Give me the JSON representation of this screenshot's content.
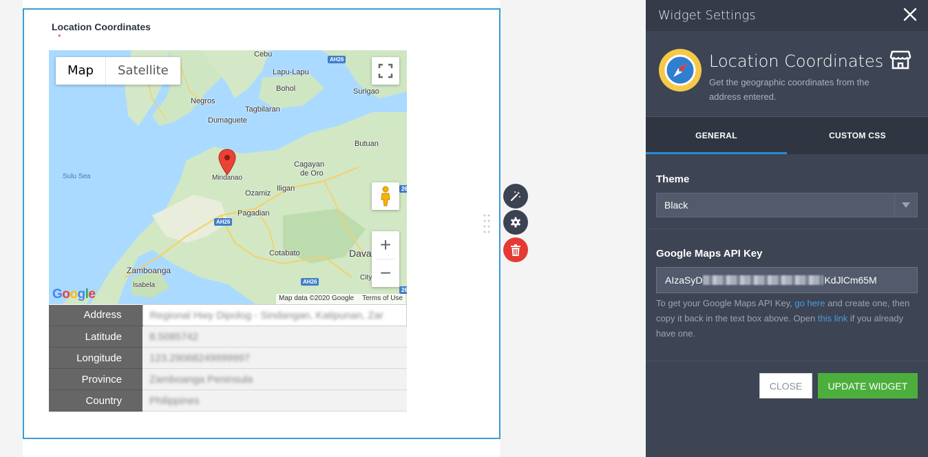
{
  "form": {
    "field_label": "Location Coordinates",
    "required_marker": "*"
  },
  "map": {
    "map_type_buttons": [
      "Map",
      "Satellite"
    ],
    "active_type": "Map",
    "labels": {
      "cebu": "Cebu",
      "lapu_lapu": "Lapu-Lapu",
      "bohol": "Bohol",
      "negros": "Negros",
      "surigao": "Surigao",
      "tagbilaran": "Tagbilaran",
      "dumaguete": "Dumaguete",
      "butuan": "Butuan",
      "sulu_sea": "Sulu Sea",
      "cagayan": "Cagayan",
      "de_oro": "de Oro",
      "mindanao": "Mindanao",
      "iligan": "Iligan",
      "ozamiz": "Ozamiz",
      "pagadian": "Pagadian",
      "cotabato": "Cotabato",
      "dava": "Dava",
      "city": "City",
      "zamboanga": "Zamboanga",
      "isabela": "Isabela"
    },
    "road_shields": {
      "ah26_a": "AH26",
      "ah26_b": "AH26",
      "ah26_c": "AH26",
      "ah26_d": "26",
      "ah26_e": "26"
    },
    "google_logo": "Google",
    "attribution": "Map data ©2020 Google",
    "terms": "Terms of Use",
    "zoom_in": "+",
    "zoom_out": "−"
  },
  "address_table": {
    "rows": [
      {
        "key": "Address",
        "value": "Regional Hwy Dipolog - Sindangan, Katipunan, Zar"
      },
      {
        "key": "Latitude",
        "value": "8.5085742"
      },
      {
        "key": "Longitude",
        "value": "123.29068249999997"
      },
      {
        "key": "Province",
        "value": "Zamboanga Peninsula"
      },
      {
        "key": "Country",
        "value": "Philippines"
      }
    ]
  },
  "panel": {
    "title": "Widget Settings",
    "widget_title": "Location Coordinates",
    "widget_desc": "Get the geographic coordinates from the address entered.",
    "tabs": [
      "GENERAL",
      "CUSTOM CSS"
    ],
    "theme_label": "Theme",
    "theme_value": "Black",
    "api_label": "Google Maps API Key",
    "api_prefix": "AIzaSyD",
    "api_suffix": "KdJlCm65M",
    "help": {
      "part1": "To get your Google Maps API Key, ",
      "link1": "go here",
      "part2": " and create one, then copy it back in the text box above. Open ",
      "link2": "this link",
      "part3": " if you already have one."
    },
    "close_button": "CLOSE",
    "update_button": "UPDATE WIDGET"
  },
  "colors": {
    "accent_blue": "#3a9bd6",
    "panel_bg": "#3d4453",
    "update_green": "#4caf3d",
    "delete_red": "#e53935"
  }
}
